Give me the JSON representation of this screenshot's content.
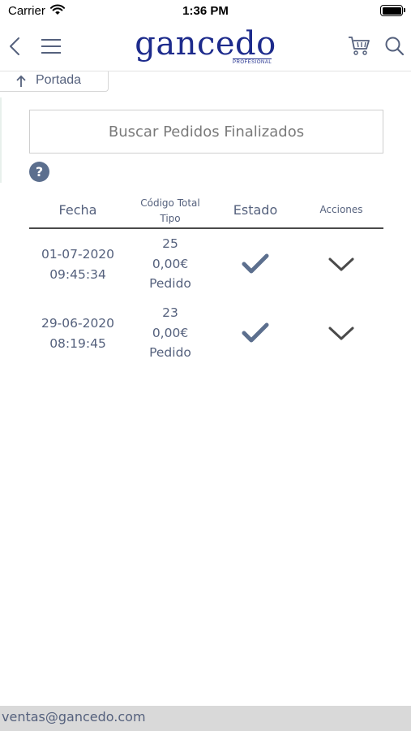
{
  "status_bar": {
    "carrier": "Carrier",
    "time": "1:36 PM",
    "battery_level": 1.0
  },
  "nav_bar": {
    "brand": "gancedo",
    "brand_sub": "PROFESIONAL",
    "icons": [
      "back-icon",
      "menu-icon",
      "cart-icon",
      "search-icon"
    ]
  },
  "breadcrumb": {
    "label": "Portada",
    "icon": "arrow-up-icon"
  },
  "search": {
    "placeholder": "Buscar Pedidos Finalizados"
  },
  "help": {
    "label": "?"
  },
  "table": {
    "headers": {
      "fecha": "Fecha",
      "codigo_total": "Código Total",
      "tipo": "Tipo",
      "estado": "Estado",
      "acciones": "Acciones"
    },
    "rows": [
      {
        "date": "01-07-2020",
        "time": "09:45:34",
        "codigo": "25",
        "total": "0,00€",
        "tipo": "Pedido",
        "estado_icon": "checkmark-icon",
        "accion_icon": "chevron-down-icon"
      },
      {
        "date": "29-06-2020",
        "time": "08:19:45",
        "codigo": "23",
        "total": "0,00€",
        "tipo": "Pedido",
        "estado_icon": "checkmark-icon",
        "accion_icon": "chevron-down-icon"
      }
    ]
  },
  "footer": {
    "email": "ventas@gancedo.com"
  },
  "colors": {
    "brand": "#1d2b8c",
    "text": "#55617d",
    "check": "#5c6f8e",
    "footer_bg": "#d9d9d9"
  }
}
